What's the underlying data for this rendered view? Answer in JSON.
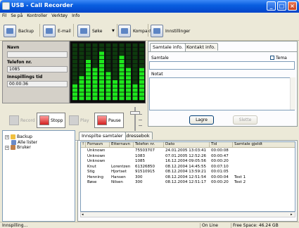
{
  "window": {
    "title": "USB - Call Recorder"
  },
  "menu": [
    "Fil",
    "Se på",
    "Kontroller",
    "Verktøy",
    "Info"
  ],
  "toolbar": {
    "backup": "Backup",
    "email": "E-mail",
    "search": "Søke",
    "compact": "Kompakt",
    "settings": "Innstillinger"
  },
  "info": {
    "name_label": "Navn",
    "name_value": "",
    "phone_label": "Telefon nr.",
    "phone_value": "1085",
    "time_label": "Innspillings tid",
    "time_value": "00:00:36"
  },
  "controls": {
    "record": "Record",
    "stop": "Stopp",
    "play": "Play",
    "pause": "Pause",
    "record_enabled": false,
    "play_enabled": false
  },
  "conversation_panel": {
    "tabs": [
      "Samtale info.",
      "Kontakt info."
    ],
    "samtale_label": "Samtale",
    "theme_label": "Tema",
    "note_label": "Notat",
    "save_button": "Lagre",
    "delete_button": "Slette"
  },
  "tree": {
    "items": [
      {
        "label": "Backup",
        "expandable": true
      },
      {
        "label": "Alle lister",
        "expandable": false
      },
      {
        "label": "Bruker",
        "expandable": true
      }
    ]
  },
  "bottom_tabs": [
    "Innspilte samtaler",
    "Adressebok"
  ],
  "table": {
    "columns": [
      "!",
      "Fornavn",
      "Etternavn",
      "Telefon nr.",
      "Dato",
      "Tid",
      "Samtale gjeldt"
    ],
    "rows": [
      [
        "",
        "Unknown",
        "",
        "75503707",
        "24.01.2005 13:03:41",
        "00:00:08",
        ""
      ],
      [
        "",
        "Unknown",
        "",
        "1083",
        "07.01.2005 12:52:26",
        "00:00:47",
        ""
      ],
      [
        "",
        "Unknown",
        "",
        "1085",
        "16.12.2004 09:05:56",
        "00:00:20",
        ""
      ],
      [
        "",
        "Knut",
        "Lorentzen",
        "61326850",
        "08.12.2004 14:45:55",
        "00:07:10",
        ""
      ],
      [
        "",
        "Stig",
        "Hjortset",
        "91510915",
        "08.12.2004 13:59:21",
        "00:01:05",
        ""
      ],
      [
        "",
        "Henning",
        "Hansen",
        "300",
        "08.12.2004 12:51:54",
        "00:00:04",
        "Test 1"
      ],
      [
        "",
        "Bøse",
        "Nilsen",
        "300",
        "08.12.2004 12:51:17",
        "00:00:20",
        "Test 2"
      ]
    ]
  },
  "status": {
    "left": "Innspilling...",
    "middle": "On Line",
    "right": "Free Space: 46.24 GB"
  },
  "colors": {
    "title_bar": "#0a5fe0",
    "eq_green": "#1ee81e",
    "eq_background": "#0c0c0c"
  }
}
